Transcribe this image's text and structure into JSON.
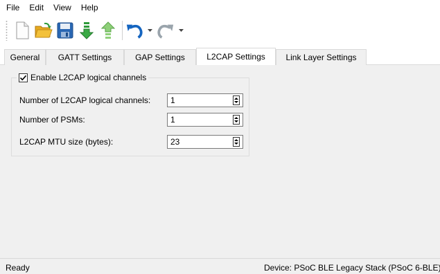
{
  "menu": {
    "items": [
      "File",
      "Edit",
      "View",
      "Help"
    ]
  },
  "toolbar": {
    "buttons": [
      "new-file-icon",
      "open-folder-icon",
      "save-icon",
      "import-icon",
      "export-icon",
      "undo-icon",
      "redo-icon"
    ]
  },
  "tabs": {
    "items": [
      "General",
      "GATT Settings",
      "GAP Settings",
      "L2CAP Settings",
      "Link Layer Settings"
    ],
    "active": "L2CAP Settings"
  },
  "l2cap": {
    "enable_label": "Enable L2CAP logical channels",
    "enable_checked": true,
    "fields": [
      {
        "label": "Number of L2CAP logical channels:",
        "value": "1"
      },
      {
        "label": "Number of PSMs:",
        "value": "1"
      },
      {
        "label": "L2CAP MTU size (bytes):",
        "value": "23"
      }
    ]
  },
  "status": {
    "left": "Ready",
    "right": "Device: PSoC BLE Legacy Stack (PSoC 6-BLE)"
  },
  "colors": {
    "undo_blue": "#1565c0",
    "redo_gray": "#9aa4ac",
    "arrow_green": "#2e9a3a",
    "folder_yellow": "#f3c13a",
    "save_blue": "#2a67b3"
  }
}
